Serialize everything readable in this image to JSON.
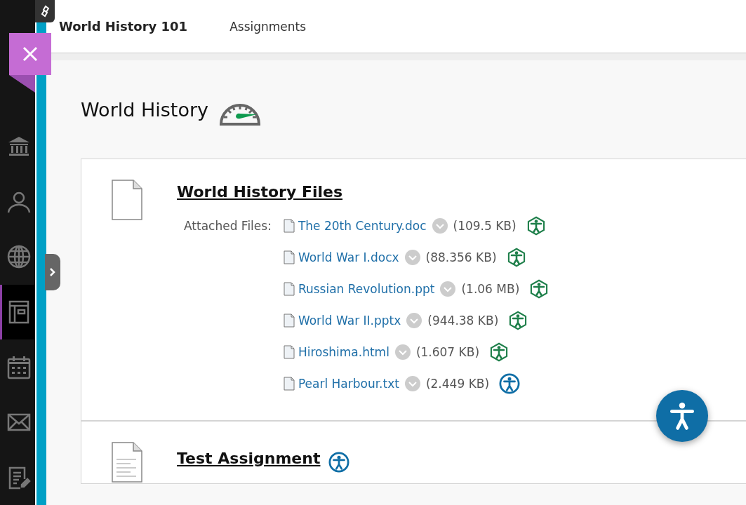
{
  "sidebar": {
    "items": [
      {
        "kind": "institution",
        "selected": false
      },
      {
        "kind": "profile",
        "selected": false
      },
      {
        "kind": "globe",
        "selected": false
      },
      {
        "kind": "courses",
        "selected": true
      },
      {
        "kind": "calendar",
        "selected": false
      },
      {
        "kind": "messages",
        "selected": false
      },
      {
        "kind": "grades",
        "selected": false
      }
    ]
  },
  "top_nav": {
    "course": "World History 101",
    "tabs": [
      {
        "label": "Assignments"
      }
    ]
  },
  "page_title": "World History",
  "items": [
    {
      "title": "World History Files",
      "kind": "files",
      "attached_label": "Attached Files:",
      "files": [
        {
          "name": "The 20th Century.doc",
          "size": "(109.5 KB)",
          "accessibility": {
            "kind": "hexagon",
            "color": "#1e7f4a"
          }
        },
        {
          "name": "World War I.docx",
          "size": "(88.356 KB)",
          "accessibility": {
            "kind": "hexagon",
            "color": "#1e7f4a"
          }
        },
        {
          "name": "Russian Revolution.ppt",
          "size": "(1.06 MB)",
          "accessibility": {
            "kind": "hexagon",
            "color": "#1e7f4a"
          }
        },
        {
          "name": "World War II.pptx",
          "size": "(944.38 KB)",
          "accessibility": {
            "kind": "hexagon",
            "color": "#1e7f4a"
          }
        },
        {
          "name": "Hiroshima.html",
          "size": "(1.607 KB)",
          "accessibility": {
            "kind": "hexagon",
            "color": "#1e7f4a"
          }
        },
        {
          "name": "Pearl Harbour.txt",
          "size": "(2.449 KB)",
          "accessibility": {
            "kind": "circle",
            "color": "#0f6ea6"
          }
        }
      ]
    },
    {
      "title": "Test Assignment",
      "kind": "assignment",
      "accessibility": {
        "kind": "circle",
        "color": "#0f6ea6"
      }
    }
  ]
}
